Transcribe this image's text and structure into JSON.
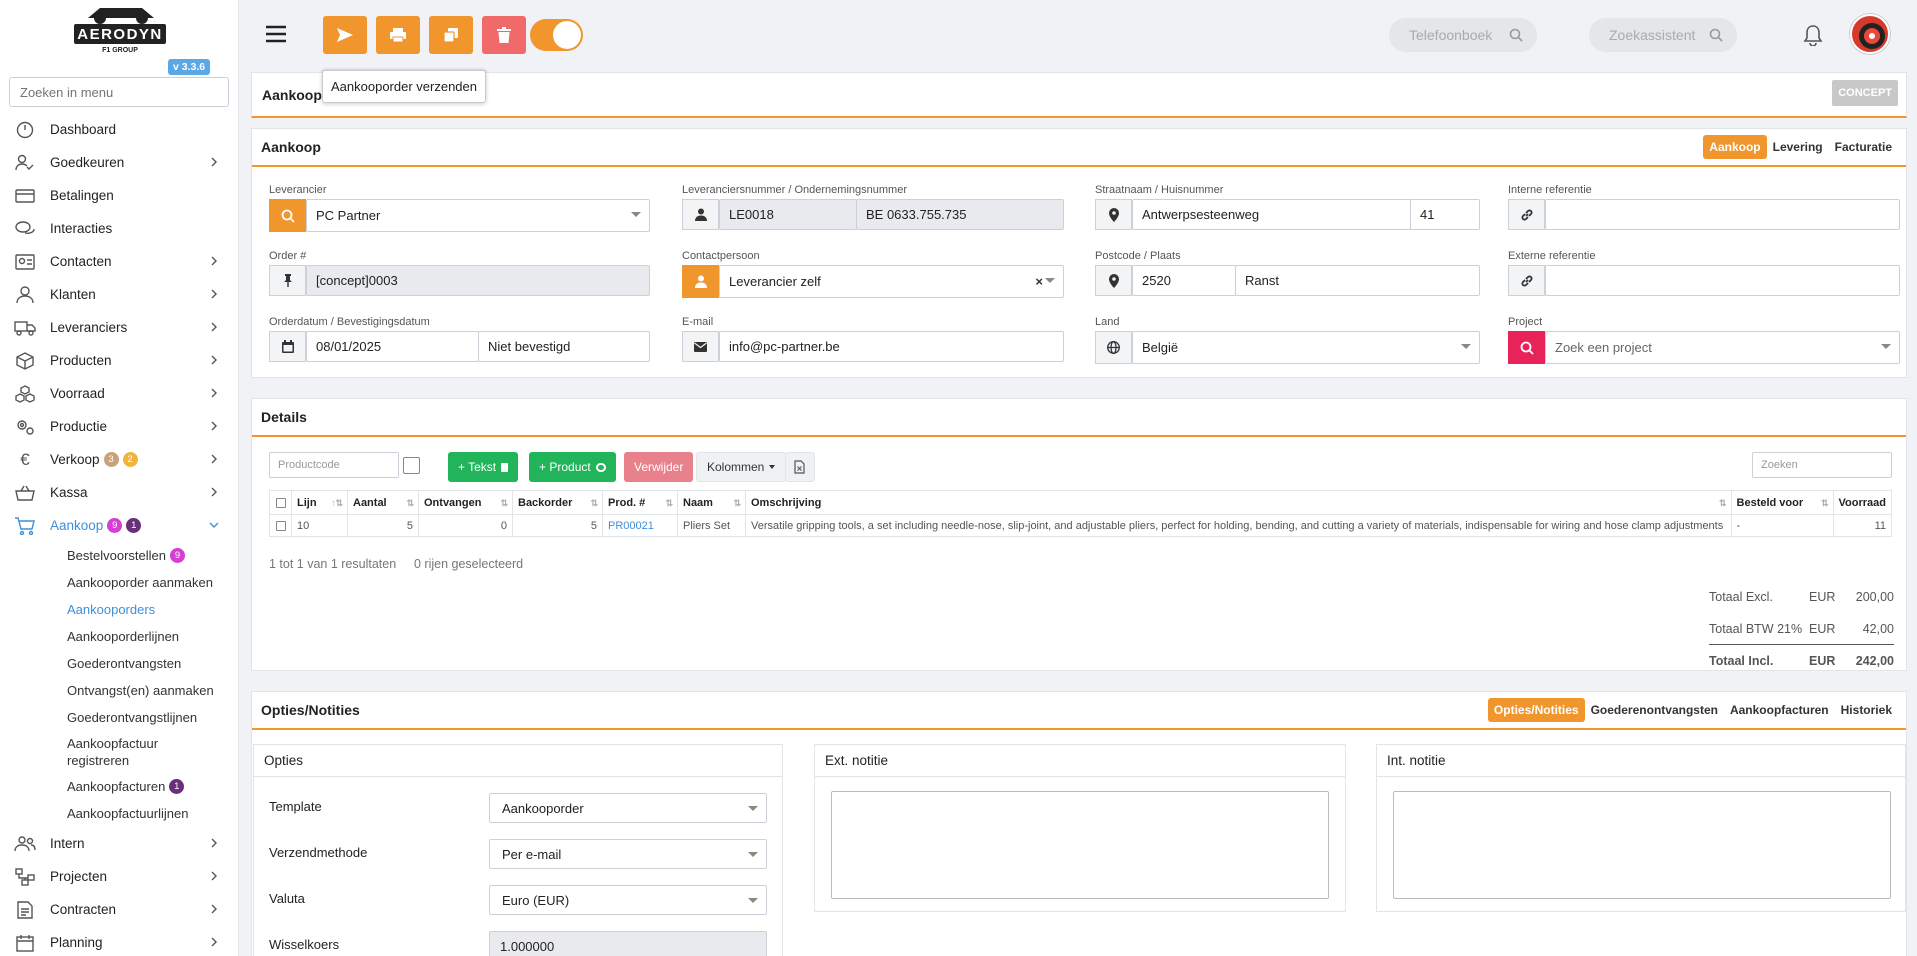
{
  "sidebar": {
    "logo_text": "AERODYN",
    "logo_sub": "F1 GROUP",
    "version": "v 3.3.6",
    "search_placeholder": "Zoeken in menu",
    "items": [
      {
        "label": "Dashboard",
        "icon": "dashboard-icon"
      },
      {
        "label": "Goedkeuren",
        "icon": "approve-icon"
      },
      {
        "label": "Betalingen",
        "icon": "payments-icon"
      },
      {
        "label": "Interacties",
        "icon": "chat-icon"
      },
      {
        "label": "Contacten",
        "icon": "contacts-icon"
      },
      {
        "label": "Klanten",
        "icon": "customers-icon"
      },
      {
        "label": "Leveranciers",
        "icon": "truck-icon"
      },
      {
        "label": "Producten",
        "icon": "box-icon"
      },
      {
        "label": "Voorraad",
        "icon": "stock-icon"
      },
      {
        "label": "Productie",
        "icon": "gears-icon"
      },
      {
        "label": "Verkoop",
        "icon": "euro-icon",
        "badges": [
          "3",
          "2"
        ]
      },
      {
        "label": "Kassa",
        "icon": "basket-icon"
      },
      {
        "label": "Aankoop",
        "icon": "cart-icon",
        "badges": [
          "9",
          "1"
        ]
      }
    ],
    "subitems": [
      {
        "label": "Bestelvoorstellen",
        "badge": "9"
      },
      {
        "label": "Aankooporder aanmaken"
      },
      {
        "label": "Aankooporders"
      },
      {
        "label": "Aankooporderlijnen"
      },
      {
        "label": "Goederontvangsten"
      },
      {
        "label": "Ontvangst(en) aanmaken"
      },
      {
        "label": "Goederontvangstlijnen"
      },
      {
        "label": "Aankoopfactuur registreren"
      },
      {
        "label": "Aankoopfacturen",
        "badge": "1"
      },
      {
        "label": "Aankoopfactuurlijnen"
      }
    ],
    "items_after": [
      {
        "label": "Intern",
        "icon": "people-icon"
      },
      {
        "label": "Projecten",
        "icon": "project-icon"
      },
      {
        "label": "Contracten",
        "icon": "contract-icon"
      },
      {
        "label": "Planning",
        "icon": "calendar-icon"
      }
    ]
  },
  "topbar": {
    "phonebook_placeholder": "Telefoonboek",
    "assistant_placeholder": "Zoekassistent",
    "tooltip": "Aankooporder verzenden"
  },
  "header": {
    "title": "Aankooporder",
    "status": "CONCEPT"
  },
  "purchase": {
    "title": "Aankoop",
    "tabs": [
      "Aankoop",
      "Levering",
      "Facturatie"
    ],
    "supplier_label": "Leverancier",
    "supplier": "PC Partner",
    "supplier_nr_label": "Leveranciersnummer / Ondernemingsnummer",
    "supplier_nr": "LE0018",
    "company_nr": "BE 0633.755.735",
    "street_label": "Straatnaam / Huisnummer",
    "street": "Antwerpsesteenweg",
    "house_nr": "41",
    "internal_ref_label": "Interne referentie",
    "internal_ref": "",
    "order_label": "Order #",
    "order": "[concept]0003",
    "contact_label": "Contactpersoon",
    "contact": "Leverancier zelf",
    "postal_label": "Postcode / Plaats",
    "postal": "2520",
    "city": "Ranst",
    "external_ref_label": "Externe referentie",
    "external_ref": "",
    "date_label": "Orderdatum / Bevestigingsdatum",
    "date": "08/01/2025",
    "confirmed": "Niet bevestigd",
    "email_label": "E-mail",
    "email": "info@pc-partner.be",
    "country_label": "Land",
    "country": "België",
    "project_label": "Project",
    "project_placeholder": "Zoek een project"
  },
  "details": {
    "title": "Details",
    "productcode_placeholder": "Productcode",
    "btn_text": "+ Tekst",
    "btn_product": "+ Product",
    "btn_delete": "Verwijder",
    "btn_columns": "Kolommen",
    "search_placeholder": "Zoeken",
    "columns": [
      "Lijn",
      "Aantal",
      "Ontvangen",
      "Backorder",
      "Prod. #",
      "Naam",
      "Omschrijving",
      "Besteld voor",
      "Voorraad"
    ],
    "rows": [
      {
        "lijn": "10",
        "aantal": "5",
        "ontvangen": "0",
        "backorder": "5",
        "prod": "PR00021",
        "naam": "Pliers Set",
        "omschrijving": "Versatile gripping tools, a set including needle-nose, slip-joint, and adjustable pliers, perfect for holding, bending, and cutting a variety of materials, indispensable for wiring and hose clamp adjustments",
        "besteld_voor": "-",
        "voorraad": "11"
      }
    ],
    "summary": "1 tot 1 van 1 resultaten",
    "selected": "0 rijen geselecteerd",
    "totals": [
      {
        "label": "Totaal Excl.",
        "cur": "EUR",
        "value": "200,00"
      },
      {
        "label": "Totaal BTW 21%",
        "cur": "EUR",
        "value": "42,00"
      },
      {
        "label": "Totaal Incl.",
        "cur": "EUR",
        "value": "242,00"
      }
    ]
  },
  "options": {
    "title": "Opties/Notities",
    "tabs": [
      "Opties/Notities",
      "Goederenontvangsten",
      "Aankoopfacturen",
      "Historiek"
    ],
    "opties_title": "Opties",
    "template_label": "Template",
    "template": "Aankooporder",
    "shipping_label": "Verzendmethode",
    "shipping": "Per e-mail",
    "currency_label": "Valuta",
    "currency": "Euro (EUR)",
    "rate_label": "Wisselkoers",
    "rate": "1.000000",
    "ext_note_title": "Ext. notitie",
    "int_note_title": "Int. notitie"
  },
  "colors": {
    "accent": "#f0962c",
    "danger": "#e8235a",
    "success": "#1db954",
    "link": "#3f8fd9"
  }
}
